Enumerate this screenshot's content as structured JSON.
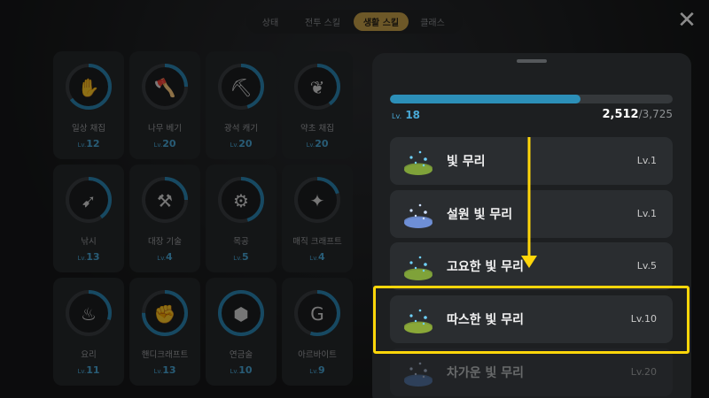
{
  "tabs": [
    {
      "label": "상태",
      "active": false
    },
    {
      "label": "전투 스킬",
      "active": false
    },
    {
      "label": "생활 스킬",
      "active": true
    },
    {
      "label": "클래스",
      "active": false
    }
  ],
  "close_icon": "close-icon",
  "skills": [
    {
      "name": "일상 채집",
      "level": "12",
      "icon": "hand-gather-icon",
      "progress": 0.65
    },
    {
      "name": "나무 베기",
      "level": "20",
      "icon": "axe-icon",
      "progress": 0.25
    },
    {
      "name": "광석 캐기",
      "level": "20",
      "icon": "pickaxe-icon",
      "progress": 0.45
    },
    {
      "name": "약초 채집",
      "level": "20",
      "icon": "herb-icon",
      "progress": 0.4
    },
    {
      "name": "낚시",
      "level": "13",
      "icon": "fishing-rod-icon",
      "progress": 0.4
    },
    {
      "name": "대장 기술",
      "level": "4",
      "icon": "anvil-icon",
      "progress": 0.25
    },
    {
      "name": "목공",
      "level": "5",
      "icon": "saw-icon",
      "progress": 0.45
    },
    {
      "name": "매직 크래프트",
      "level": "4",
      "icon": "magic-craft-icon",
      "progress": 0.2
    },
    {
      "name": "요리",
      "level": "11",
      "icon": "pot-icon",
      "progress": 0.3
    },
    {
      "name": "핸디크래프트",
      "level": "13",
      "icon": "handicraft-icon",
      "progress": 0.75
    },
    {
      "name": "연금술",
      "level": "10",
      "icon": "alchemy-icon",
      "progress": 1.0
    },
    {
      "name": "아르바이트",
      "level": "9",
      "icon": "money-bag-icon",
      "progress": 0.55
    }
  ],
  "lv_prefix": "Lv.",
  "panel": {
    "level_prefix": "Lv.",
    "level": "18",
    "xp_current": "2,512",
    "xp_max": "/3,725",
    "progress": 0.674
  },
  "colors": {
    "accent": "#2c8fb8",
    "level_text": "#48a9d6",
    "active_tab": "#c7a04a",
    "highlight": "#ffd60a",
    "arrow": "#ffd60a"
  },
  "lights": [
    {
      "name": "빛 무리",
      "level": "Lv.1",
      "base_color": "#7fa23a"
    },
    {
      "name": "설원 빛 무리",
      "level": "Lv.1",
      "base_color": "#6f8fd6"
    },
    {
      "name": "고요한 빛 무리",
      "level": "Lv.5",
      "base_color": "#7fa23a"
    },
    {
      "name": "따스한 빛 무리",
      "level": "Lv.10",
      "base_color": "#8aa838"
    },
    {
      "name": "차가운 빛 무리",
      "level": "Lv.20",
      "base_color": "#4f7fc4"
    }
  ]
}
